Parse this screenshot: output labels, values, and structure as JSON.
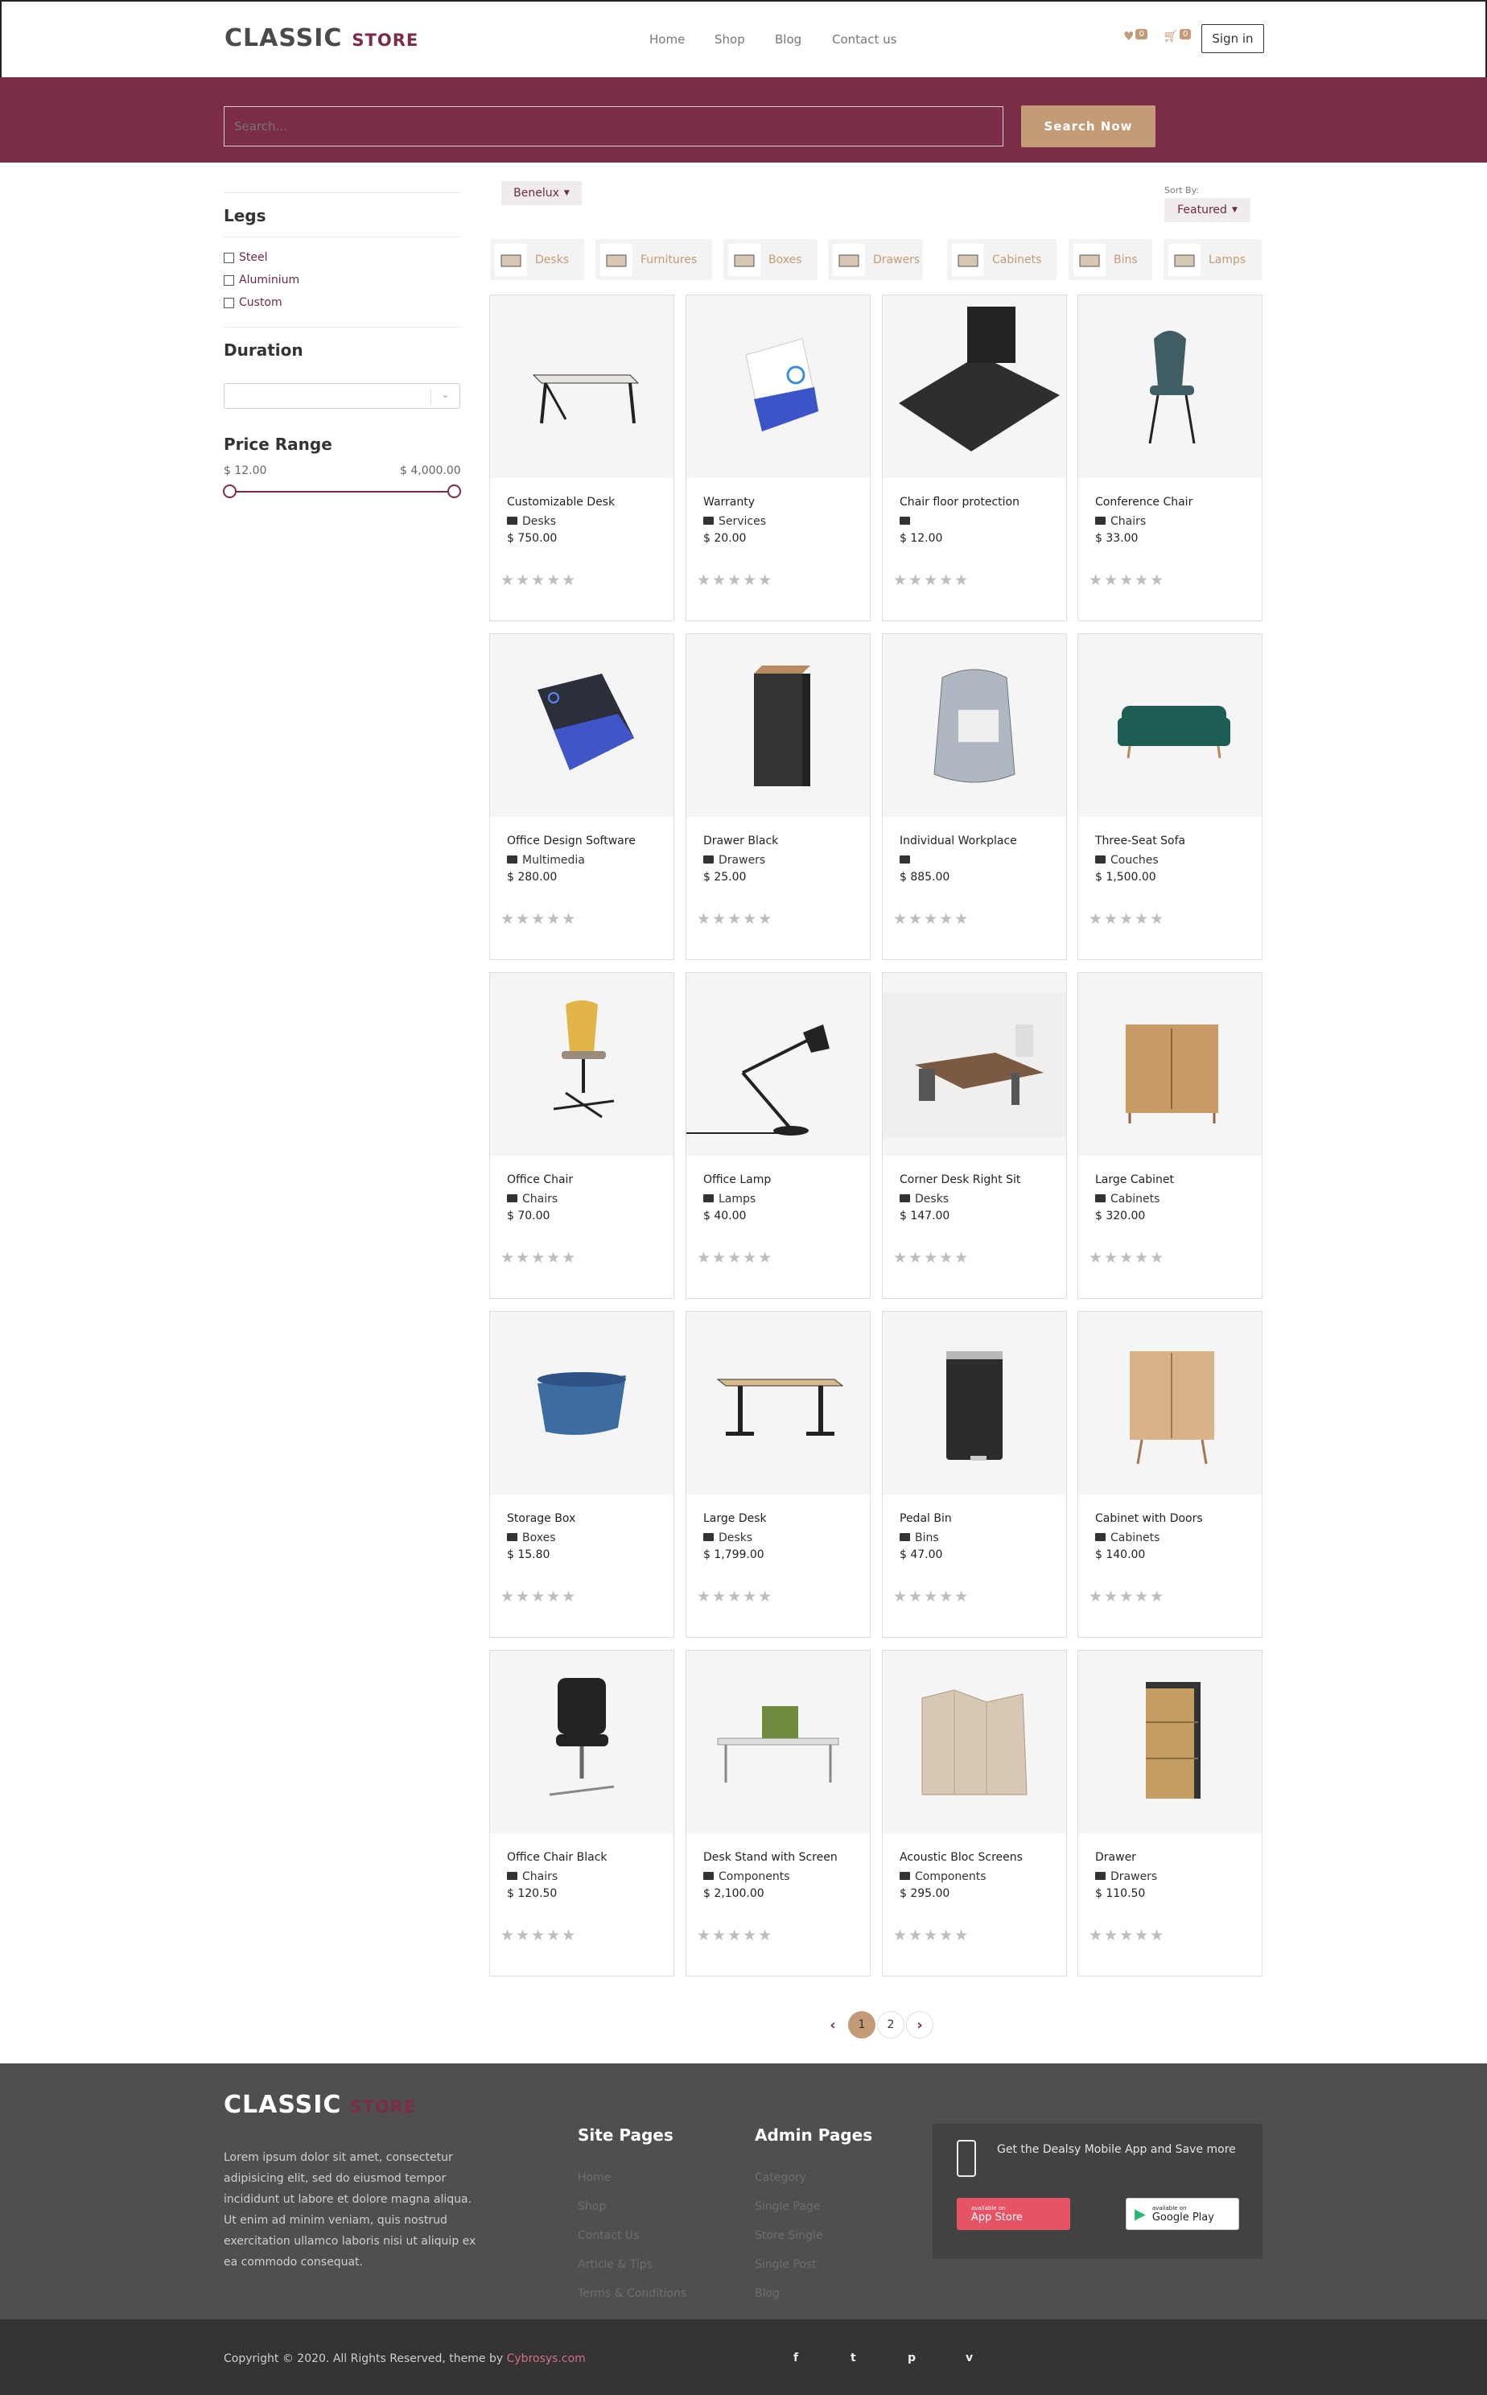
{
  "header": {
    "logo_main": "CLASSIC",
    "logo_sub": "STORE",
    "nav": [
      "Home",
      "Shop",
      "Blog",
      "Contact us"
    ],
    "wishlist_count": "0",
    "cart_count": "0",
    "signin_label": "Sign in"
  },
  "search": {
    "placeholder": "Search...",
    "button_label": "Search Now"
  },
  "sidebar": {
    "legs_title": "Legs",
    "legs_options": [
      "Steel",
      "Aluminium",
      "Custom"
    ],
    "duration_title": "Duration",
    "price_title": "Price Range",
    "price_min": "$ 12.00",
    "price_max": "$ 4,000.00"
  },
  "filters": {
    "pricelist_label": "Benelux",
    "sort_label": "Sort By:",
    "sort_value": "Featured"
  },
  "categories": [
    "Desks",
    "Furnitures",
    "Boxes",
    "Drawers",
    "Cabinets",
    "Bins",
    "Lamps"
  ],
  "products": [
    {
      "name": "Customizable Desk",
      "category": "Desks",
      "price": "$ 750.00"
    },
    {
      "name": "Warranty",
      "category": "Services",
      "price": "$ 20.00"
    },
    {
      "name": "Chair floor protection",
      "category": "",
      "price": "$ 12.00"
    },
    {
      "name": "Conference Chair",
      "category": "Chairs",
      "price": "$ 33.00"
    },
    {
      "name": "Office Design Software",
      "category": "Multimedia",
      "price": "$ 280.00"
    },
    {
      "name": "Drawer Black",
      "category": "Drawers",
      "price": "$ 25.00"
    },
    {
      "name": "Individual Workplace",
      "category": "",
      "price": "$ 885.00"
    },
    {
      "name": "Three-Seat Sofa",
      "category": "Couches",
      "price": "$ 1,500.00"
    },
    {
      "name": "Office Chair",
      "category": "Chairs",
      "price": "$ 70.00"
    },
    {
      "name": "Office Lamp",
      "category": "Lamps",
      "price": "$ 40.00"
    },
    {
      "name": "Corner Desk Right Sit",
      "category": "Desks",
      "price": "$ 147.00"
    },
    {
      "name": "Large Cabinet",
      "category": "Cabinets",
      "price": "$ 320.00"
    },
    {
      "name": "Storage Box",
      "category": "Boxes",
      "price": "$ 15.80"
    },
    {
      "name": "Large Desk",
      "category": "Desks",
      "price": "$ 1,799.00"
    },
    {
      "name": "Pedal Bin",
      "category": "Bins",
      "price": "$ 47.00"
    },
    {
      "name": "Cabinet with Doors",
      "category": "Cabinets",
      "price": "$ 140.00"
    },
    {
      "name": "Office Chair Black",
      "category": "Chairs",
      "price": "$ 120.50"
    },
    {
      "name": "Desk Stand with Screen",
      "category": "Components",
      "price": "$ 2,100.00"
    },
    {
      "name": "Acoustic Bloc Screens",
      "category": "Components",
      "price": "$ 295.00"
    },
    {
      "name": "Drawer",
      "category": "Drawers",
      "price": "$ 110.50"
    }
  ],
  "pagination": {
    "pages": [
      "1",
      "2"
    ],
    "active": "1",
    "prev": "‹",
    "next": "›"
  },
  "footer": {
    "logo_main": "CLASSIC",
    "logo_sub": "STORE",
    "about": "Lorem ipsum dolor sit amet, consectetur adipisicing elit, sed do eiusmod tempor incididunt ut labore et dolore magna aliqua. Ut enim ad minim veniam, quis nostrud exercitation ullamco laboris nisi ut aliquip ex ea commodo consequat.",
    "site_pages_title": "Site Pages",
    "site_pages": [
      "Home",
      "Shop",
      "Contact Us",
      "Article & Tips",
      "Terms & Conditions"
    ],
    "admin_pages_title": "Admin Pages",
    "admin_pages": [
      "Category",
      "Single Page",
      "Store Single",
      "Single Post",
      "Blog"
    ],
    "app_text": "Get the Dealsy Mobile App and Save more",
    "appstore_small": "available on",
    "appstore_big": "App Store",
    "googleplay_small": "available on",
    "googleplay_big": "Google Play"
  },
  "bottom": {
    "copyright": "Copyright © 2020. All Rights Reserved, theme by",
    "copyright_link": "Cybrosys.com",
    "social": [
      "f",
      "t",
      "p",
      "v"
    ]
  },
  "colors": {
    "brand": "#7a2d44",
    "accent": "#c39b77",
    "footer": "#4f4f4f",
    "bottom": "#333333"
  }
}
